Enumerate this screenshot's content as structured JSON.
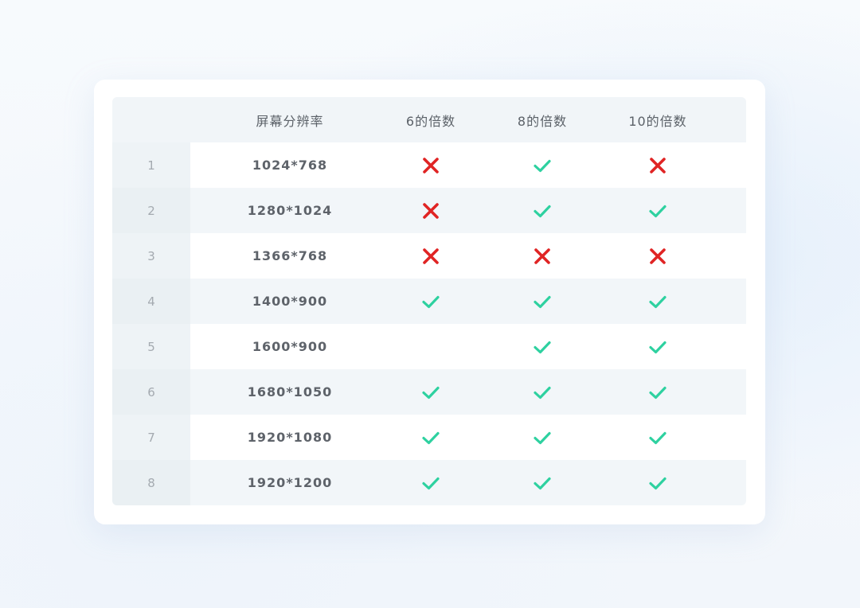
{
  "table": {
    "headers": {
      "index": "",
      "resolution": "屏幕分辨率",
      "multiple_6": "6的倍数",
      "multiple_8": "8的倍数",
      "multiple_10": "10的倍数"
    },
    "rows": [
      {
        "index": "1",
        "resolution": "1024*768",
        "m6": "no",
        "m8": "yes",
        "m10": "no"
      },
      {
        "index": "2",
        "resolution": "1280*1024",
        "m6": "no",
        "m8": "yes",
        "m10": "yes"
      },
      {
        "index": "3",
        "resolution": "1366*768",
        "m6": "no",
        "m8": "no",
        "m10": "no"
      },
      {
        "index": "4",
        "resolution": "1400*900",
        "m6": "yes",
        "m8": "yes",
        "m10": "yes"
      },
      {
        "index": "5",
        "resolution": "1600*900",
        "m6": "none",
        "m8": "yes",
        "m10": "yes"
      },
      {
        "index": "6",
        "resolution": "1680*1050",
        "m6": "yes",
        "m8": "yes",
        "m10": "yes"
      },
      {
        "index": "7",
        "resolution": "1920*1080",
        "m6": "yes",
        "m8": "yes",
        "m10": "yes"
      },
      {
        "index": "8",
        "resolution": "1920*1200",
        "m6": "yes",
        "m8": "yes",
        "m10": "yes"
      }
    ]
  },
  "icons": {
    "yes": "check-icon",
    "no": "cross-icon"
  },
  "colors": {
    "check": "#2ed1a0",
    "cross": "#e02424"
  }
}
